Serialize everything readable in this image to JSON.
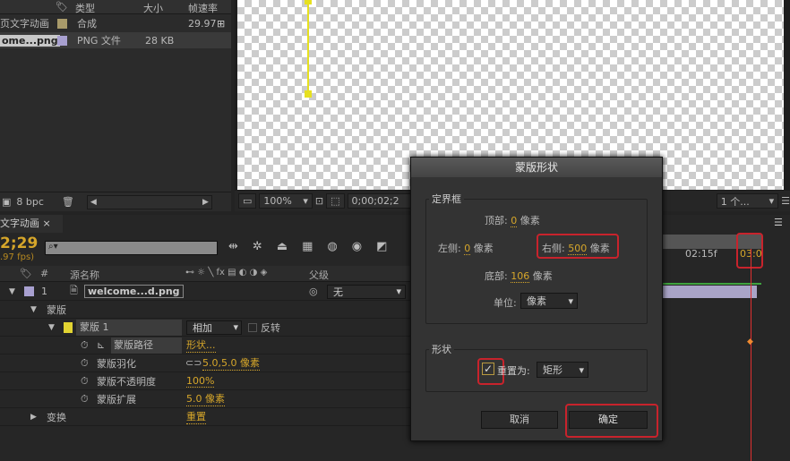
{
  "project": {
    "headers": {
      "type": "类型",
      "size": "大小",
      "fps": "帧速率"
    },
    "items": [
      {
        "name": "页文字动画",
        "type": "合成",
        "size": "",
        "fps": "29.97",
        "color": "#a89a6a"
      },
      {
        "name": "ome...png",
        "type": "PNG 文件",
        "size": "28 KB",
        "fps": "",
        "color": "#a8a0d0"
      }
    ],
    "bpc": "8 bpc"
  },
  "viewer": {
    "zoom": "100%",
    "time": "0;00;02;2",
    "views": "1 个..."
  },
  "timeline": {
    "tab": "文字动画",
    "timecode": "2;29",
    "fps": ".97 fps)",
    "col_num": "#",
    "col_source": "源名称",
    "col_parent": "父级",
    "ruler_label": "02:15f",
    "ruler_end": "03:0",
    "layer": {
      "num": "1",
      "name": "welcome...d.png",
      "parent": "无"
    },
    "rows": {
      "masks": "蒙版",
      "mask1": "蒙版 1",
      "mode": "相加",
      "invert": "反转",
      "path": "蒙版路径",
      "path_val": "形状...",
      "feather": "蒙版羽化",
      "feather_val": "5.0,5.0 像素",
      "opacity": "蒙版不透明度",
      "opacity_val": "100%",
      "expansion": "蒙版扩展",
      "expansion_val": "5.0 像素",
      "transform": "变换",
      "transform_val": "重置"
    }
  },
  "dialog": {
    "title": "蒙版形状",
    "bbox_label": "定界框",
    "top_label": "顶部:",
    "top": "0",
    "left_label": "左侧:",
    "left": "0",
    "right_label": "右侧:",
    "right": "500",
    "bottom_label": "底部:",
    "bottom": "106",
    "unit_word": "像素",
    "units_label": "单位:",
    "units": "像素",
    "shape_label": "形状",
    "reset_label": "重置为:",
    "reset_checked": true,
    "shape": "矩形",
    "cancel": "取消",
    "ok": "确定"
  }
}
